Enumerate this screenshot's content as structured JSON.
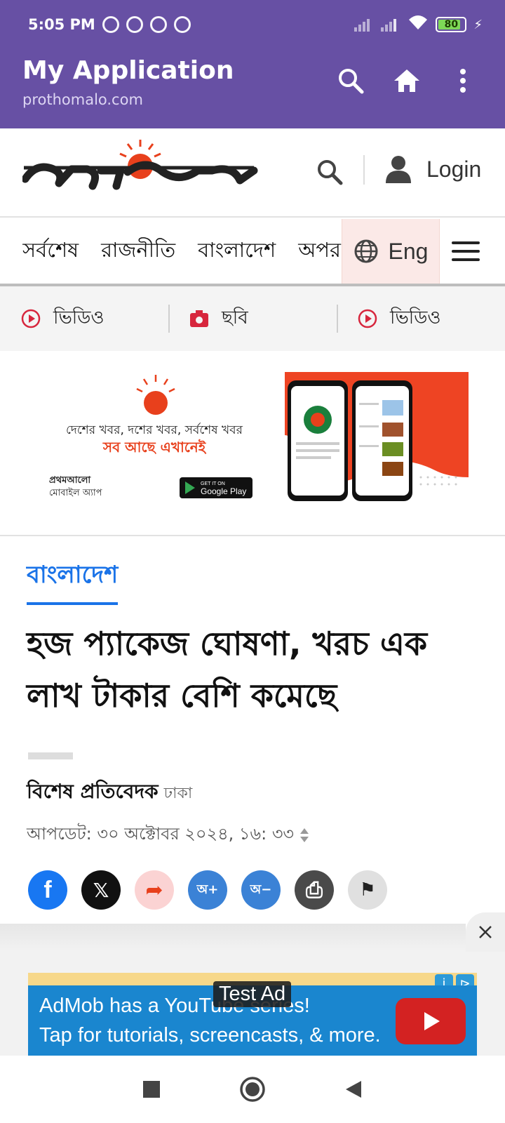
{
  "status": {
    "time": "5:05 PM",
    "battery": "80"
  },
  "app": {
    "title": "My Application",
    "subtitle": "prothomalo.com"
  },
  "header": {
    "login_label": "Login"
  },
  "nav": {
    "items": [
      "সর্বশেষ",
      "রাজনীতি",
      "বাংলাদেশ",
      "অপর"
    ],
    "lang_label": "Eng"
  },
  "media": {
    "items": [
      {
        "label": "ভিডিও",
        "icon": "play-circle-icon"
      },
      {
        "label": "ছবি",
        "icon": "camera-icon"
      },
      {
        "label": "ভিডিও",
        "icon": "play-circle-icon"
      }
    ]
  },
  "banner": {
    "line1": "দেশের খবর, দশের খবর, সর্বশেষ খবর",
    "line2": "সব আছে এখানেই",
    "app_label_1": "প্রথমআলো",
    "app_label_2": "মোবাইল অ্যাপ",
    "store_small": "GET IT ON",
    "store_big": "Google Play"
  },
  "article": {
    "section": "বাংলাদেশ",
    "headline": "হজ প্যাকেজ ঘোষণা, খরচ এক লাখ টাকার বেশি কমেছে",
    "author": "বিশেষ প্রতিবেদক",
    "location": "ঢাকা",
    "updated": "আপডেট: ৩০ অক্টোবর ২০২৪, ১৬: ৩৩",
    "share_buttons": [
      {
        "name": "facebook",
        "label": "f",
        "color": "#1877F2"
      },
      {
        "name": "x",
        "label": "𝕏",
        "color": "#111111"
      },
      {
        "name": "share",
        "label": "➦",
        "color": "#FBD3D3"
      },
      {
        "name": "font-increase",
        "label": "অ+",
        "color": "#3B82D6"
      },
      {
        "name": "font-decrease",
        "label": "অ−",
        "color": "#3B82D6"
      },
      {
        "name": "print",
        "label": "⎙",
        "color": "#4A4A4A"
      },
      {
        "name": "bookmark",
        "label": "⚑",
        "color": "#E0E0E0"
      }
    ]
  },
  "ad": {
    "line1": "AdMob has a YouTube series!",
    "line2": "Tap for tutorials, screencasts, & more.",
    "badge": "Test Ad"
  },
  "colors": {
    "app_bar": "#6750A4",
    "accent_blue": "#1a73e8",
    "logo_red": "#E8401C"
  }
}
